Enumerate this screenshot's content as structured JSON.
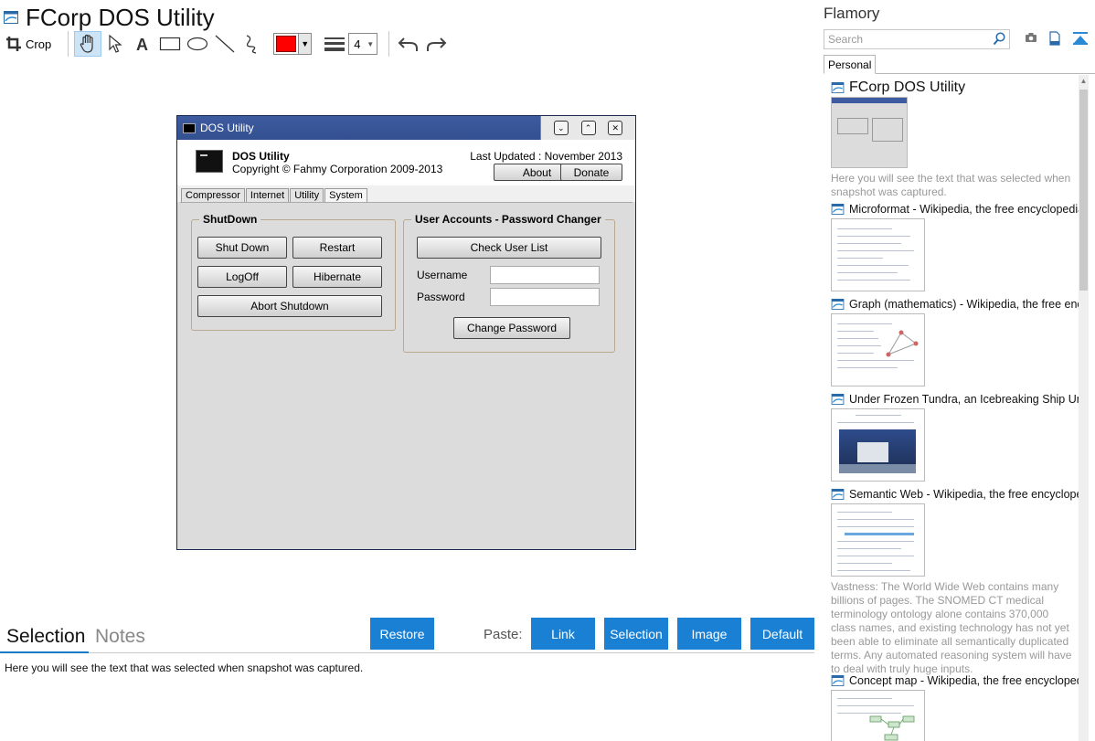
{
  "main": {
    "title": "FCorp DOS Utility",
    "toolbar": {
      "crop_label": "Crop",
      "stroke_width": "4",
      "color": "#ff0000"
    }
  },
  "snapshot": {
    "window_title": "DOS Utility",
    "app_name": "DOS Utility",
    "copyright": "Copyright © Fahmy Corporation 2009-2013",
    "last_updated": "Last Updated : November 2013",
    "about_label": "About",
    "donate_label": "Donate",
    "tabs": [
      "Compressor",
      "Internet",
      "Utility",
      "System"
    ],
    "shutdown": {
      "title": "ShutDown",
      "shut_down": "Shut Down",
      "restart": "Restart",
      "logoff": "LogOff",
      "hibernate": "Hibernate",
      "abort": "Abort Shutdown"
    },
    "accounts": {
      "title": "User Accounts - Password Changer",
      "check_users": "Check User List",
      "username_label": "Username",
      "password_label": "Password",
      "change_password": "Change Password"
    }
  },
  "bottom": {
    "tab_selection": "Selection",
    "tab_notes": "Notes",
    "restore_label": "Restore",
    "paste_label": "Paste:",
    "link_label": "Link",
    "selection_label": "Selection",
    "image_label": "Image",
    "default_label": "Default",
    "selected_text": "Here you will see the text that was selected when snapshot was captured."
  },
  "sidebar": {
    "title": "Flamory",
    "search_placeholder": "Search",
    "tab_personal": "Personal",
    "entries": [
      {
        "title": "FCorp DOS Utility",
        "desc": "Here you will see the text that was selected when snapshot was captured."
      },
      {
        "title": "Microformat - Wikipedia, the free encyclopedia"
      },
      {
        "title": "Graph (mathematics) - Wikipedia, the free encyclopedia"
      },
      {
        "title": "Under Frozen Tundra, an Icebreaking Ship Uncovers"
      },
      {
        "title": "Semantic Web - Wikipedia, the free encyclopedia",
        "desc": "Vastness: The World Wide Web contains many billions of pages. The SNOMED CT medical terminology ontology alone contains 370,000 class names, and existing technology has not yet been able to eliminate all semantically duplicated terms. Any automated reasoning system will have to deal with truly huge inputs."
      },
      {
        "title": "Concept map - Wikipedia, the free encyclopedia"
      }
    ]
  },
  "colors": {
    "accent_blue": "#1a80d4",
    "window_title_bar": "#3e5ba1"
  }
}
